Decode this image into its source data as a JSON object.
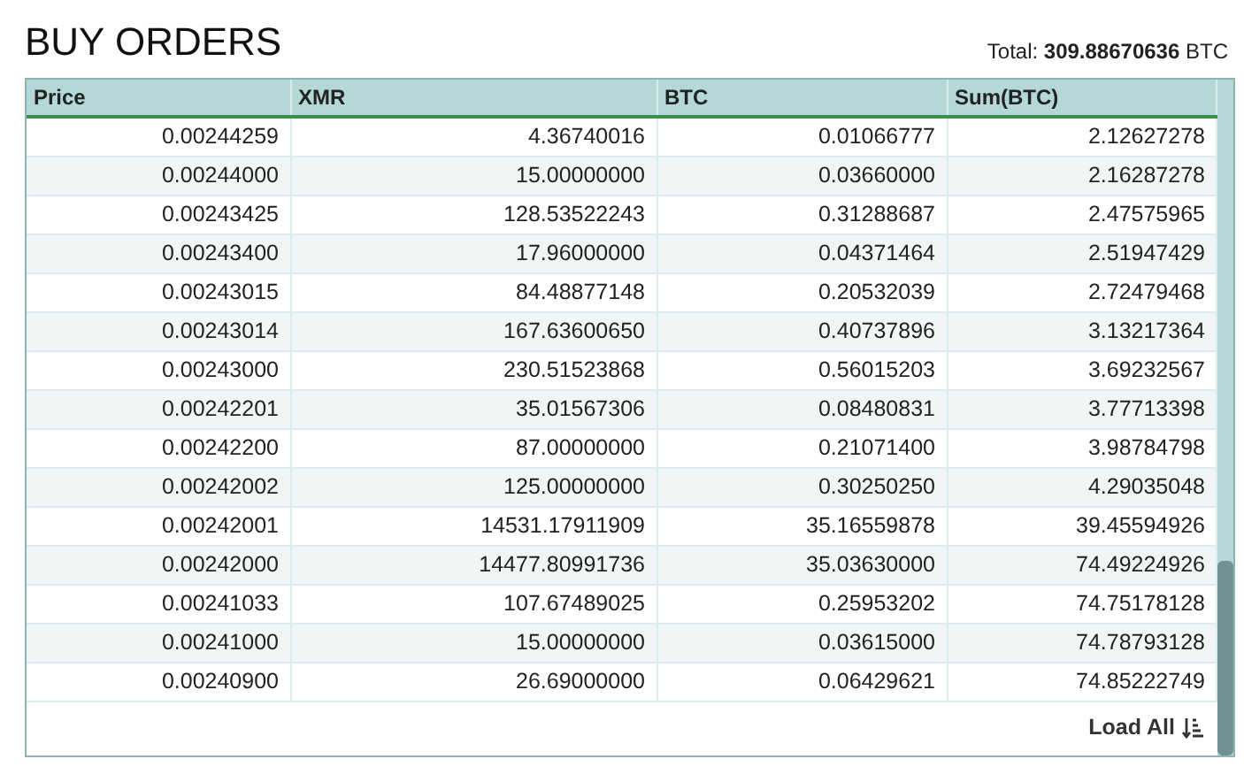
{
  "title": "BUY ORDERS",
  "total": {
    "label": "Total:",
    "value": "309.88670636",
    "unit": "BTC"
  },
  "table": {
    "columns": [
      "Price",
      "XMR",
      "BTC",
      "Sum(BTC)"
    ],
    "rows": [
      [
        "0.00244259",
        "4.36740016",
        "0.01066777",
        "2.12627278"
      ],
      [
        "0.00244000",
        "15.00000000",
        "0.03660000",
        "2.16287278"
      ],
      [
        "0.00243425",
        "128.53522243",
        "0.31288687",
        "2.47575965"
      ],
      [
        "0.00243400",
        "17.96000000",
        "0.04371464",
        "2.51947429"
      ],
      [
        "0.00243015",
        "84.48877148",
        "0.20532039",
        "2.72479468"
      ],
      [
        "0.00243014",
        "167.63600650",
        "0.40737896",
        "3.13217364"
      ],
      [
        "0.00243000",
        "230.51523868",
        "0.56015203",
        "3.69232567"
      ],
      [
        "0.00242201",
        "35.01567306",
        "0.08480831",
        "3.77713398"
      ],
      [
        "0.00242200",
        "87.00000000",
        "0.21071400",
        "3.98784798"
      ],
      [
        "0.00242002",
        "125.00000000",
        "0.30250250",
        "4.29035048"
      ],
      [
        "0.00242001",
        "14531.17911909",
        "35.16559878",
        "39.45594926"
      ],
      [
        "0.00242000",
        "14477.80991736",
        "35.03630000",
        "74.49224926"
      ],
      [
        "0.00241033",
        "107.67489025",
        "0.25953202",
        "74.75178128"
      ],
      [
        "0.00241000",
        "15.00000000",
        "0.03615000",
        "74.78793128"
      ],
      [
        "0.00240900",
        "26.69000000",
        "0.06429621",
        "74.85222749"
      ]
    ]
  },
  "load_all": "Load All"
}
